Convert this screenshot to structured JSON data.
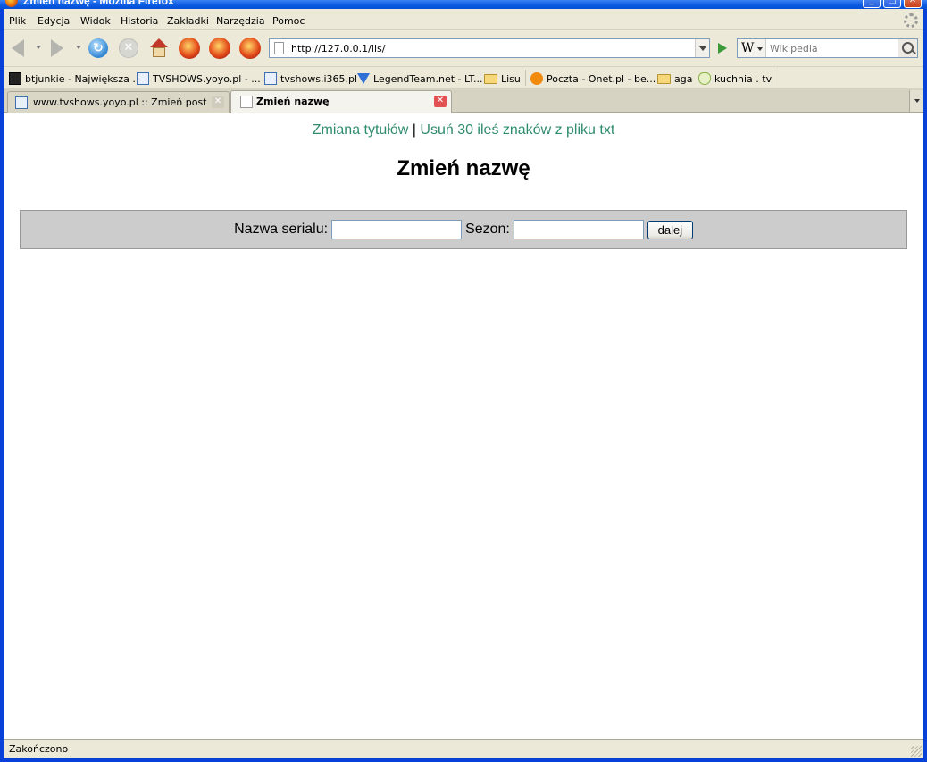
{
  "window": {
    "title": "Zmień nazwę - Mozilla Firefox",
    "controls": {
      "minimize": "_",
      "maximize": "□",
      "close": "✕"
    }
  },
  "menubar": {
    "items": [
      "Plik",
      "Edycja",
      "Widok",
      "Historia",
      "Zakładki",
      "Narzędzia",
      "Pomoc"
    ]
  },
  "navbar": {
    "url": "http://127.0.0.1/lis/",
    "search_engine": "W",
    "search_placeholder": "Wikipedia"
  },
  "bookmarks": [
    {
      "label": "btjunkie - Największa ...",
      "icon": "btjunkie-icon"
    },
    {
      "label": "TVSHOWS.yoyo.pl - ...",
      "icon": "avid-icon"
    },
    {
      "label": "tvshows.i365.pl",
      "icon": "avid-icon"
    },
    {
      "label": "LegendTeam.net - LT...",
      "icon": "legendteam-icon"
    },
    {
      "label": "Lisu",
      "icon": "folder-icon"
    },
    {
      "label": "Poczta - Onet.pl - be...",
      "icon": "onet-icon"
    },
    {
      "label": "aga",
      "icon": "folder-icon"
    },
    {
      "label": "kuchnia . tv",
      "icon": "kuchnia-icon"
    }
  ],
  "tabs": [
    {
      "label": "www.tvshows.yoyo.pl :: Zmień post",
      "active": false
    },
    {
      "label": "Zmień nazwę",
      "active": true
    }
  ],
  "page": {
    "links": [
      "Zmiana tytułów",
      "Usuń 30 ileś znaków z pliku txt"
    ],
    "separator": "|",
    "title": "Zmień nazwę",
    "form": {
      "series_label": "Nazwa serialu:",
      "series_value": "",
      "season_label": "Sezon:",
      "season_value": "",
      "submit_label": "dalej"
    }
  },
  "statusbar": {
    "text": "Zakończono"
  },
  "colors": {
    "link": "#2e8b6e",
    "form_bg": "#cccccc",
    "chrome": "#ece9d8",
    "titlebar": "#0a5ae0"
  }
}
